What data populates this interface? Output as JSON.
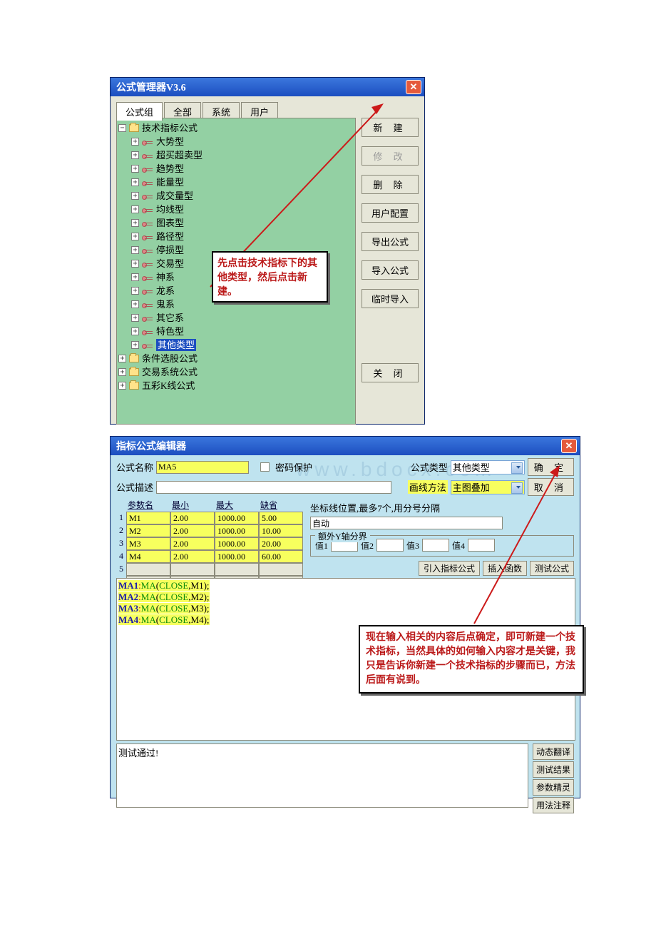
{
  "win1": {
    "title": "公式管理器V3.6",
    "tabs": [
      "公式组",
      "全部",
      "系统",
      "用户"
    ],
    "tree": {
      "root": "技术指标公式",
      "children": [
        "大势型",
        "超买超卖型",
        "趋势型",
        "能量型",
        "成交量型",
        "均线型",
        "图表型",
        "路径型",
        "停损型",
        "交易型",
        "神系",
        "龙系",
        "鬼系",
        "其它系",
        "特色型",
        "其他类型"
      ],
      "siblings": [
        "条件选股公式",
        "交易系统公式",
        "五彩K线公式"
      ]
    },
    "buttons": {
      "new": "新  建",
      "modify": "修  改",
      "delete": "删  除",
      "userconfig": "用户配置",
      "export": "导出公式",
      "import": "导入公式",
      "tempimport": "临时导入",
      "close": "关  闭"
    },
    "annotation": "先点击技术指标下的其他类型，然后点击新建。"
  },
  "win2": {
    "title": "指标公式编辑器",
    "labels": {
      "name": "公式名称",
      "pwd": "密码保护",
      "type": "公式类型",
      "desc": "公式描述",
      "draw": "画线方法",
      "paramname": "参数名",
      "min": "最小",
      "max": "最大",
      "default": "缺省",
      "coord": "坐标线位置,最多7个,用分号分隔",
      "auto": "自动",
      "extray": "额外Y轴分界",
      "val1": "值1",
      "val2": "值2",
      "val3": "值3",
      "val4": "值4"
    },
    "values": {
      "name": "MA5",
      "type_sel": "其他类型",
      "draw_sel": "主图叠加"
    },
    "params": [
      {
        "n": "M1",
        "min": "2.00",
        "max": "1000.00",
        "def": "5.00"
      },
      {
        "n": "M2",
        "min": "2.00",
        "max": "1000.00",
        "def": "10.00"
      },
      {
        "n": "M3",
        "min": "2.00",
        "max": "1000.00",
        "def": "20.00"
      },
      {
        "n": "M4",
        "min": "2.00",
        "max": "1000.00",
        "def": "60.00"
      }
    ],
    "buttons": {
      "ok": "确  定",
      "cancel": "取  消",
      "ref": "引入指标公式",
      "func": "插入函数",
      "test": "测试公式",
      "dyntrans": "动态翻译",
      "testres": "测试结果",
      "paramwiz": "参数精灵",
      "usage": "用法注释"
    },
    "code": {
      "l1a": "MA1",
      "l1b": ":",
      "l1c": "MA",
      "l1d": "(",
      "l1e": "CLOSE",
      "l1f": ",",
      "l1g": "M1",
      "l1h": ");",
      "l2a": "MA2",
      "l2g": "M2",
      "l3a": "MA3",
      "l3g": "M3",
      "l4a": "MA4",
      "l4g": "M4"
    },
    "testresult": "测试通过!",
    "annotation": "现在输入相关的内容后点确定，即可新建一个技术指标，当然具体的如何输入内容才是关键，我只是告诉你新建一个技术指标的步骤而已，方法后面有说到。",
    "watermark": "www.bdocx.com"
  }
}
